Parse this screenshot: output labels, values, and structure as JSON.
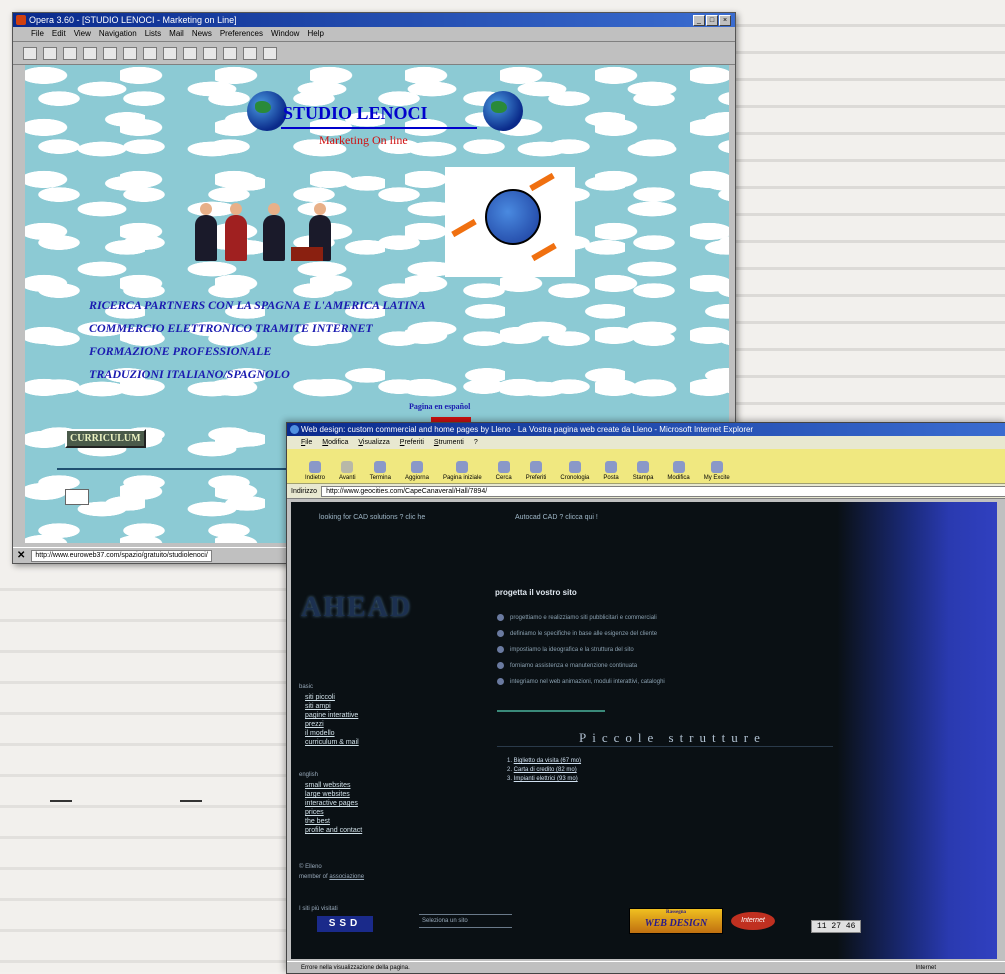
{
  "opera": {
    "title": "Opera 3.60 - [STUDIO LENOCI - Marketing on Line]",
    "menu": [
      "File",
      "Edit",
      "View",
      "Navigation",
      "Lists",
      "Mail",
      "News",
      "Preferences",
      "Window",
      "Help"
    ],
    "page": {
      "heading": "STUDIO LENOCI",
      "subheading": "Marketing On line",
      "services": [
        "RICERCA PARTNERS CON LA SPAGNA E L'AMERICA LATINA",
        "COMMERCIO ELETTRONICO TRAMITE INTERNET",
        "FORMAZIONE PROFESSIONALE",
        "TRADUZIONI ITALIANO/SPAGNOLO"
      ],
      "espanol_link": "Pagina en español",
      "curriculum_button": "CURRICULUM"
    },
    "status_url": "http://www.euroweb37.com/spazio/gratuito/studiolenoci/"
  },
  "ie": {
    "title": "Web design: custom commercial and home pages by Lleno · La Vostra pagina web create da Lleno - Microsoft Internet Explorer",
    "menu": [
      "File",
      "Modifica",
      "Visualizza",
      "Preferiti",
      "Strumenti",
      "?"
    ],
    "toolbar": [
      "Indietro",
      "Avanti",
      "Termina",
      "Aggiorna",
      "Pagina iniziale",
      "Cerca",
      "Preferiti",
      "Cronologia",
      "Posta",
      "Stampa",
      "Modifica",
      "My Excite"
    ],
    "address_label": "Indirizzo",
    "address": "http://www.geocities.com/CapeCanaveral/Hall/7894/",
    "status": "Errore nella visualizzazione della pagina.",
    "status_zone": "Internet",
    "page": {
      "cad_top_left": "looking for CAD solutions ? clic he",
      "cad_top_right": "Autocad CAD ? clicca qui !",
      "logo": "AHEAD",
      "main_title": "progetta il vostro sito",
      "features": [
        "progettiamo e realizziamo siti pubblicitari e commerciali",
        "definiamo le specifiche in base alle esigenze del cliente",
        "impostiamo la ideografica e la struttura del sito",
        "forniamo assistenza e manutenzione continuata",
        "integriamo nel web animazioni, moduli interattivi, cataloghi"
      ],
      "nav_it_heading": "basic",
      "nav_it": [
        "siti piccoli",
        "siti ampi",
        "pagine interattive",
        "prezzi",
        "il modello",
        "curriculum & mail"
      ],
      "nav_en_heading": "english",
      "nav_en": [
        "small websites",
        "large websites",
        "interactive pages",
        "prices",
        "the best",
        "profile and contact"
      ],
      "footer_left_1": "© Elleno",
      "footer_left_2": "member of",
      "footer_left_link": "associazione",
      "section_title": "Piccole strutture",
      "structures": [
        "Biglietto da visita (67 mo)",
        "Carta di credito (82 mo)",
        "Impianti elettrici (93 mo)"
      ],
      "counter_label": "I siti più visitati",
      "ssd_logo": "SSD",
      "pick_label": "Seleziona un sito",
      "webdesign_top": "Rassegna",
      "webdesign_logo": "WEB DESIGN",
      "internet_logo": "Internet",
      "clock": "11 27 46"
    }
  }
}
